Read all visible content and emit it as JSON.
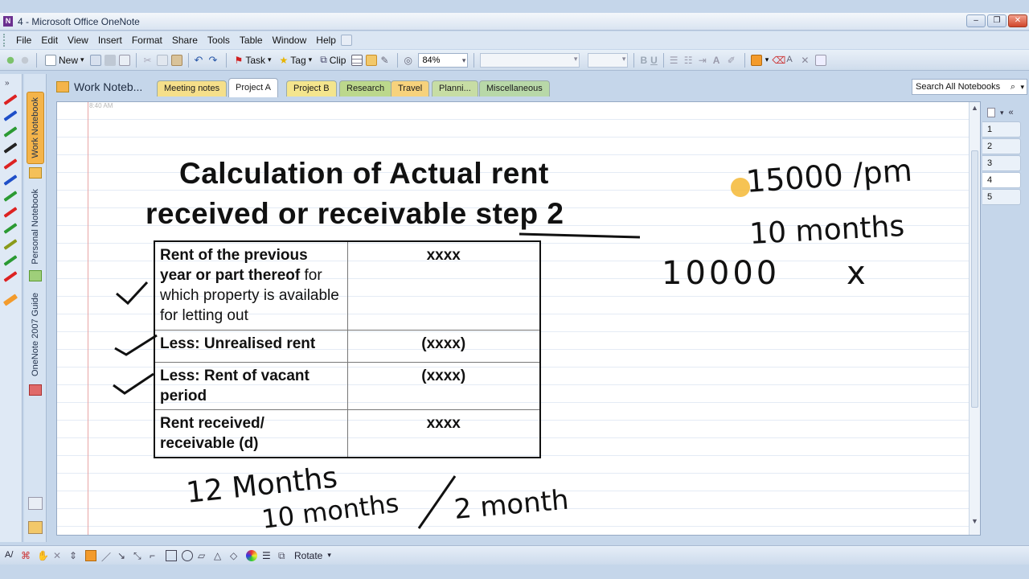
{
  "window": {
    "title": "4 - Microsoft Office OneNote",
    "app_icon": "onenote-icon"
  },
  "menu": [
    "File",
    "Edit",
    "View",
    "Insert",
    "Format",
    "Share",
    "Tools",
    "Table",
    "Window",
    "Help"
  ],
  "toolbar": {
    "new_label": "New",
    "task_label": "Task",
    "tag_label": "Tag",
    "clip_label": "Clip",
    "zoom_value": "84%",
    "bold": "B",
    "underline": "U"
  },
  "notebook": {
    "title": "Work Noteb...",
    "side_tabs": [
      "Work Notebook",
      "Personal Notebook",
      "OneNote 2007 Guide"
    ]
  },
  "sections": [
    {
      "label": "Meeting notes",
      "color": "#f5df8a"
    },
    {
      "label": "Project A",
      "color": "#ffffff",
      "active": true
    },
    {
      "label": "Project B",
      "color": "#f4e58d"
    },
    {
      "label": "Research",
      "color": "#bcd88c"
    },
    {
      "label": "Travel",
      "color": "#f7d27c"
    },
    {
      "label": "Planni...",
      "color": "#c7dda4"
    },
    {
      "label": "Miscellaneous",
      "color": "#b8d8a8"
    }
  ],
  "search": {
    "placeholder": "Search All Notebooks"
  },
  "page": {
    "timestamp": "8:40 AM",
    "title_line1": "Calculation of Actual rent",
    "title_line2_a": "received or receivable ",
    "title_line2_b": "step 2",
    "rows": [
      {
        "label": "Rent of the previous year or part thereof for which property is available for letting out",
        "value": "xxxx",
        "bold_part": "Rent of the previous year or part thereof",
        "normal_part": " for which property is available for letting out"
      },
      {
        "label": "Less: Unrealised rent",
        "value": "(xxxx)"
      },
      {
        "label": "Less: Rent of vacant period",
        "value": "(xxxx)"
      },
      {
        "label": "Rent received/ receivable (d)",
        "value": "xxxx"
      }
    ],
    "handwriting": {
      "note1": "15000 /pm",
      "note2": "10 months",
      "note3": "10000",
      "note3_suffix": "x",
      "note4": "12 Months",
      "note5": "10 months",
      "note6": "2 month"
    }
  },
  "page_tabs": [
    "1",
    "2",
    "3",
    "4",
    "5"
  ],
  "bottom_toolbar": {
    "rotate_label": "Rotate"
  }
}
